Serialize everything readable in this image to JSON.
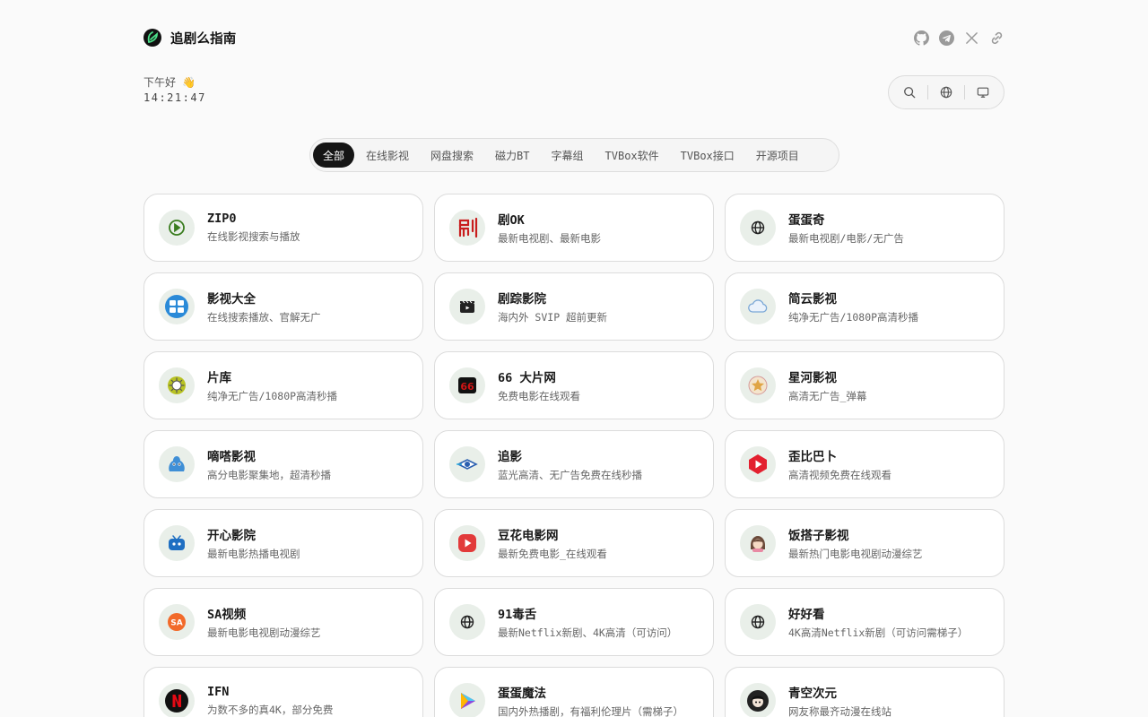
{
  "header": {
    "title": "追剧么指南",
    "social": [
      {
        "icon": "github-icon"
      },
      {
        "icon": "telegram-icon"
      },
      {
        "icon": "x-icon"
      },
      {
        "icon": "link-icon"
      }
    ]
  },
  "greeting": {
    "text": "下午好 👋",
    "time": "14:21:47"
  },
  "tools": [
    "search-icon",
    "globe-icon",
    "monitor-icon"
  ],
  "tabs": [
    "全部",
    "在线影视",
    "网盘搜索",
    "磁力BT",
    "字幕组",
    "TVBox软件",
    "TVBox接口",
    "开源项目"
  ],
  "active_tab": "全部",
  "cards": [
    {
      "name": "ZIP0",
      "desc": "在线影视搜索与播放",
      "icon": "play-circle-icon",
      "color": "#3a7d1f"
    },
    {
      "name": "剧OK",
      "desc": "最新电视剧、最新电影",
      "icon": "ju-ok-logo-icon",
      "color": "#c81d1d"
    },
    {
      "name": "蛋蛋奇",
      "desc": "最新电视剧/电影/无广告",
      "icon": "globe-icon",
      "color": "#222222"
    },
    {
      "name": "影视大全",
      "desc": "在线搜索播放、官解无广",
      "icon": "yingshi-daquan-logo-icon",
      "color": "#2a8ad8"
    },
    {
      "name": "剧踪影院",
      "desc": "海内外 SVIP 超前更新",
      "icon": "clapperboard-icon",
      "color": "#222222"
    },
    {
      "name": "简云影视",
      "desc": "纯净无广告/1080P高清秒播",
      "icon": "cloud-icon",
      "color": "#7aa7d6"
    },
    {
      "name": "片库",
      "desc": "纯净无广告/1080P高清秒播",
      "icon": "sun-icon",
      "color": "#b8c223"
    },
    {
      "name": "66 大片网",
      "desc": "免费电影在线观看",
      "icon": "66-logo-icon",
      "color": "#d01515"
    },
    {
      "name": "星河影视",
      "desc": "高清无广告_弹幕",
      "icon": "star-badge-icon",
      "color": "#e0a545"
    },
    {
      "name": "嘀嗒影视",
      "desc": "高分电影聚集地，超清秒播",
      "icon": "blue-monster-icon",
      "color": "#3f8fd6"
    },
    {
      "name": "追影",
      "desc": "蓝光高清、无广告免费在线秒播",
      "icon": "zhuiying-logo-icon",
      "color": "#2b5fb0"
    },
    {
      "name": "歪比巴卜",
      "desc": "高清视频免费在线观看",
      "icon": "red-play-icon",
      "color": "#e3202f"
    },
    {
      "name": "开心影院",
      "desc": "最新电影热播电视剧",
      "icon": "tv-robot-icon",
      "color": "#1f6fc2"
    },
    {
      "name": "豆花电影网",
      "desc": "最新免费电影_在线观看",
      "icon": "red-play-square-icon",
      "color": "#e23a3a"
    },
    {
      "name": "饭搭子影视",
      "desc": "最新热门电影电视剧动漫综艺",
      "icon": "avatar-girl-icon",
      "color": "#6b4a3a"
    },
    {
      "name": "SA视频",
      "desc": "最新电影电视剧动漫综艺",
      "icon": "sa-logo-icon",
      "color": "#f26a2a"
    },
    {
      "name": "91毒舌",
      "desc": "最新Netflix新剧、4K高清（可访问）",
      "icon": "globe-icon",
      "color": "#222222"
    },
    {
      "name": "好好看",
      "desc": "4K高清Netflix新剧（可访问需梯子）",
      "icon": "globe-icon",
      "color": "#222222"
    },
    {
      "name": "IFN",
      "desc": "为数不多的真4K，部分免费",
      "icon": "netflix-n-icon",
      "color": "#e50914"
    },
    {
      "name": "蛋蛋魔法",
      "desc": "国内外热播剧，有福利伦理片（需梯子）",
      "icon": "colorful-play-icon",
      "color": "#8a4be0"
    },
    {
      "name": "青空次元",
      "desc": "网友称最齐动漫在线站",
      "icon": "anime-avatar-icon",
      "color": "#333333"
    }
  ]
}
